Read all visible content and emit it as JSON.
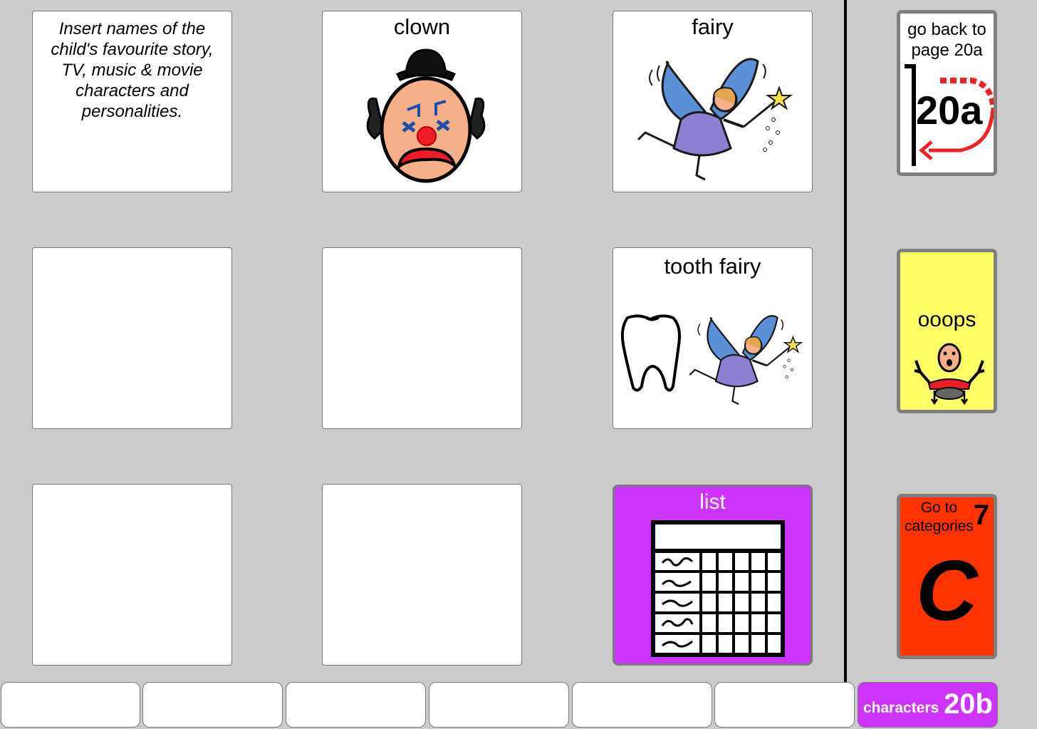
{
  "grid": {
    "note": "Insert names of the child's favourite story, TV, music & movie characters and personalities.",
    "clown_label": "clown",
    "fairy_label": "fairy",
    "tooth_fairy_label": "tooth fairy",
    "list_label": "list"
  },
  "sidebar": {
    "back_label": "go back to page 20a",
    "back_page": "20a",
    "oops_label": "ooops",
    "categories_label": "Go to categories",
    "categories_page": "7",
    "categories_letter": "C"
  },
  "bottom_bar": {
    "page_name": "characters",
    "page_number": "20b"
  },
  "colors": {
    "background": "#cbcbcb",
    "list_cell": "#cc33ff",
    "oops_cell": "#ffff66",
    "categories_cell": "#ff3300",
    "page_tab": "#cc33ff"
  },
  "icons": [
    "clown-icon",
    "fairy-icon",
    "tooth-icon",
    "list-icon",
    "page-back-icon",
    "person-oops-icon"
  ]
}
